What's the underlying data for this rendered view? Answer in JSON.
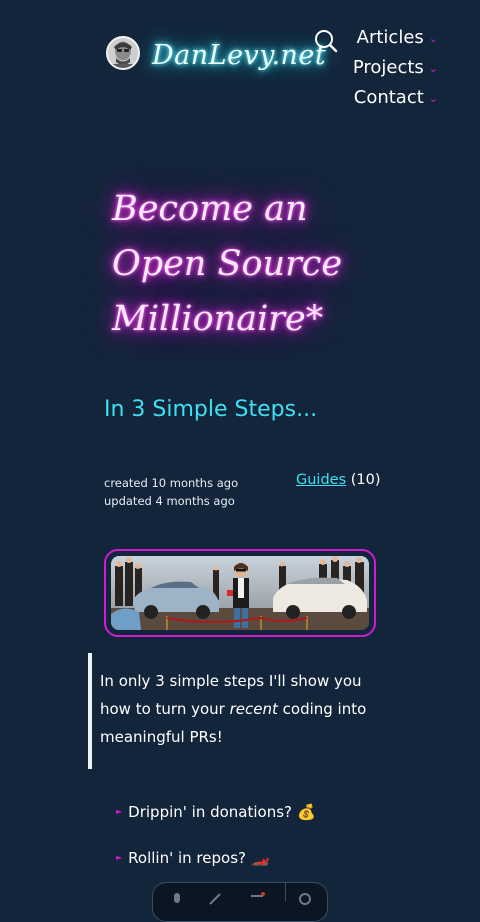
{
  "header": {
    "site_title": "DanLevy.net",
    "nav": [
      {
        "label": "Articles"
      },
      {
        "label": "Projects"
      },
      {
        "label": "Contact"
      }
    ]
  },
  "article": {
    "title_lines": [
      "Become an",
      "Open Source",
      "Millionaire*"
    ],
    "subtitle": "In 3 Simple Steps...",
    "created": "created 10 months ago",
    "updated": "updated 4 months ago",
    "category": {
      "label": "Guides",
      "count": "(10)"
    },
    "intro": {
      "before": "In only 3 simple steps I'll show you how to turn your ",
      "emphasis": "recent",
      "after": " coding into meaningful PRs!"
    },
    "bullets": [
      {
        "text": "Drippin' in donations?",
        "emoji": "💰"
      },
      {
        "text": "Rollin' in repos?",
        "emoji": "🏎️"
      }
    ]
  },
  "colors": {
    "background": "#13253a",
    "neon_cyan": "#3de0f4",
    "neon_pink": "#d21bd0",
    "text": "#ffffff"
  },
  "icons": {
    "search": "search-icon",
    "chevron": "chevron-down-icon",
    "bullet": "triangle-bullet-icon"
  }
}
